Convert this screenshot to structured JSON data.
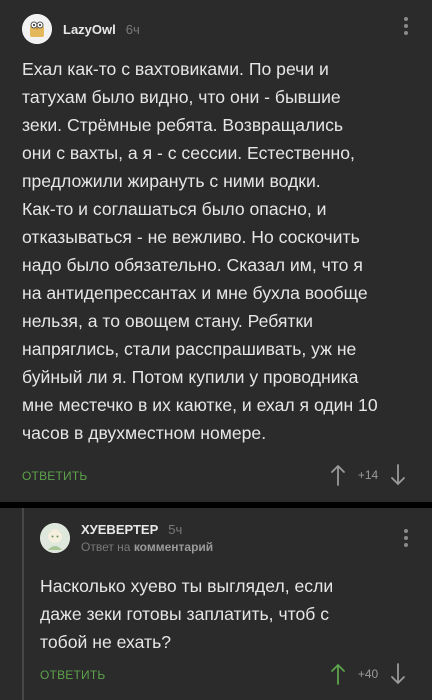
{
  "comments": [
    {
      "author": "LazyOwl",
      "time": "6ч",
      "text": "Ехал как-то с вахтовиками. По речи и\nтатухам было видно, что они - бывшие\nзеки. Стрёмные ребята. Возвращались\nони с вахты, а я - с сессии. Естественно,\nпредложили жирануть с ними водки.\nКак-то и соглашаться было опасно, и\nотказываться - не вежливо. Но соскочить\nнадо было обязательно. Сказал им, что я\nна антидепрессантах и мне бухла вообще\nнельзя, а то овощем стану. Ребятки\nнапряглись, стали расспрашивать, уж не\nбуйный ли я. Потом купили у проводника\nмне местечко в их каютке, и ехал я один 10\nчасов в двухместном номере.",
      "reply_label": "ОТВЕТИТЬ",
      "rating": "+14"
    },
    {
      "author": "ХУЕВЕРТЕР",
      "time": "5ч",
      "reply_prefix": "Ответ на",
      "reply_target": "комментарий",
      "text": "Насколько хуево ты выглядел, если\nдаже зеки готовы заплатить, чтоб с\nтобой не ехать?",
      "reply_label": "ОТВЕТИТЬ",
      "rating": "+40"
    }
  ],
  "icons": {
    "upvote": "arrow-up-icon",
    "downvote": "arrow-down-icon",
    "menu": "more-vertical-icon"
  },
  "colors": {
    "background": "#000000",
    "card": "#2b2b2b",
    "accent_green": "#5da24c",
    "muted": "#7a7a7a"
  }
}
